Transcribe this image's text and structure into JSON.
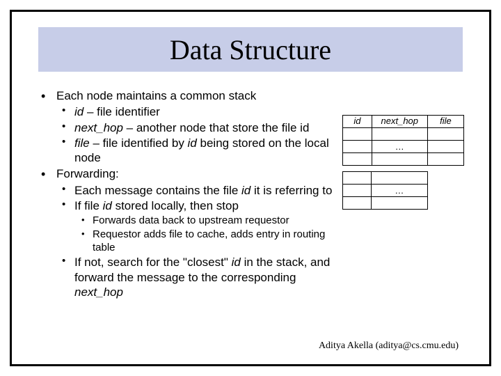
{
  "title": "Data Structure",
  "bullets": {
    "b1": "Each node maintains a common stack",
    "b1a_pre": "id",
    "b1a_post": " – file identifier",
    "b1b_pre": "next_hop",
    "b1b_post": " – another node that store the file id",
    "b1c_pre": "file",
    "b1c_mid": " – file identified by ",
    "b1c_id": "id",
    "b1c_post": " being stored on the local node",
    "b2": "Forwarding:",
    "b2a_pre": "Each message contains the file ",
    "b2a_id": "id",
    "b2a_post": " it is referring to",
    "b2b_pre": "If file ",
    "b2b_id": "id",
    "b2b_post": " stored locally, then stop",
    "b2b1": "Forwards data back to upstream requestor",
    "b2b2": "Requestor adds file to cache, adds entry in routing table",
    "b2c_pre": "If not, search for the \"closest\" ",
    "b2c_id": "id",
    "b2c_mid": " in the stack, and forward the message to the corresponding ",
    "b2c_nh": "next_hop"
  },
  "table": {
    "h1": "id",
    "h2": "next_hop",
    "h3": "file",
    "vellipsis": "…"
  },
  "footer": "Aditya Akella (aditya@cs.cmu.edu)"
}
